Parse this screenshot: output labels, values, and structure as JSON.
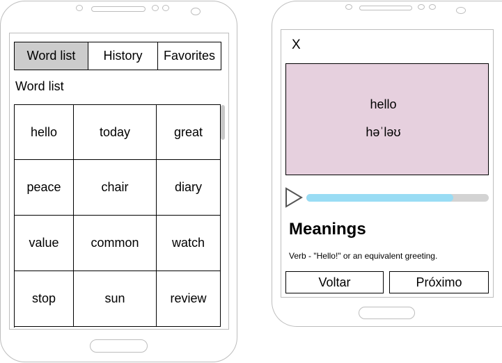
{
  "left_phone": {
    "tabs": [
      {
        "label": "Word list",
        "selected": true
      },
      {
        "label": "History",
        "selected": false
      },
      {
        "label": "Favorites",
        "selected": false
      }
    ],
    "section_title": "Word list",
    "words": [
      [
        "hello",
        "today",
        "great"
      ],
      [
        "peace",
        "chair",
        "diary"
      ],
      [
        "value",
        "common",
        "watch"
      ],
      [
        "stop",
        "sun",
        "review"
      ]
    ]
  },
  "right_phone": {
    "close_label": "X",
    "card": {
      "word": "hello",
      "pronunciation": "həˈləʊ",
      "background_color": "#e6d0de"
    },
    "audio": {
      "play_icon": "play-icon",
      "progress_fraction": 0.805,
      "progress_color": "#99dcf4",
      "track_color": "#d3d3d3"
    },
    "meanings_heading": "Meanings",
    "meaning_text": "Verb - \"Hello!\" or an equivalent greeting.",
    "back_button": "Voltar",
    "next_button": "Próximo"
  },
  "colors": {
    "selected_tab": "#cccccc",
    "frame_outline": "#bdbdbd"
  }
}
